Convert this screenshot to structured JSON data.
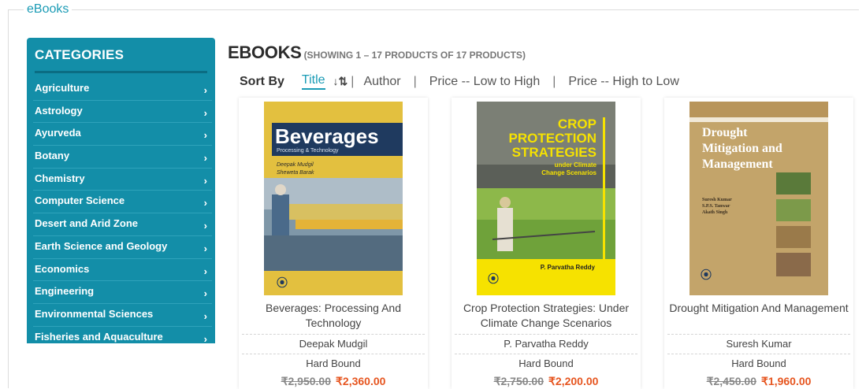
{
  "section_label": "eBooks",
  "sidebar": {
    "title": "CATEGORIES",
    "items": [
      {
        "label": "Agriculture"
      },
      {
        "label": "Astrology"
      },
      {
        "label": "Ayurveda"
      },
      {
        "label": "Botany"
      },
      {
        "label": "Chemistry"
      },
      {
        "label": "Computer Science"
      },
      {
        "label": "Desert and Arid Zone"
      },
      {
        "label": "Earth Science and Geology"
      },
      {
        "label": "Economics"
      },
      {
        "label": "Engineering"
      },
      {
        "label": "Environmental Sciences"
      },
      {
        "label": "Fisheries and Aquaculture"
      }
    ],
    "chevron": "›"
  },
  "heading": {
    "title": "EBOOKS",
    "count": "(SHOWING 1 – 17 PRODUCTS OF 17 PRODUCTS)"
  },
  "sort": {
    "label": "Sort By",
    "title": "Title",
    "order_icon": "↓⇅",
    "separator": "|",
    "author": "Author",
    "price_low": "Price -- Low to High",
    "price_high": "Price -- High to Low"
  },
  "products": [
    {
      "title": "Beverages: Processing And Technology",
      "author": "Deepak Mudgil",
      "binding": "Hard Bound",
      "price_old": "₹2,950.00",
      "price_new": "₹2,360.00",
      "cover": {
        "title": "Beverages",
        "subtitle": "Processing & Technology",
        "authors": [
          "Deepak Mudgil",
          "Sheweta Barak"
        ],
        "bg": "#e3c03f",
        "band": "#1f3a5f"
      }
    },
    {
      "title": "Crop Protection Strategies: Under Climate Change Scenarios",
      "author": "P. Parvatha Reddy",
      "binding": "Hard Bound",
      "price_old": "₹2,750.00",
      "price_new": "₹2,200.00",
      "cover": {
        "title_lines": [
          "CROP",
          "PROTECTION",
          "STRATEGIES"
        ],
        "subtitle_lines": [
          "under Climate",
          "Change Scenarios"
        ],
        "author": "P. Parvatha Reddy",
        "accent": "#f6e200"
      }
    },
    {
      "title": "Drought Mitigation And Management",
      "author": "Suresh Kumar",
      "binding": "Hard Bound",
      "price_old": "₹2,450.00",
      "price_new": "₹1,960.00",
      "cover": {
        "title_lines": [
          "Drought",
          "Mitigation and",
          "Management"
        ],
        "authors": [
          "Suresh Kumar",
          "S.P.S. Tanwar",
          "Akath Singh"
        ],
        "bg": "#c3a46a"
      }
    }
  ]
}
